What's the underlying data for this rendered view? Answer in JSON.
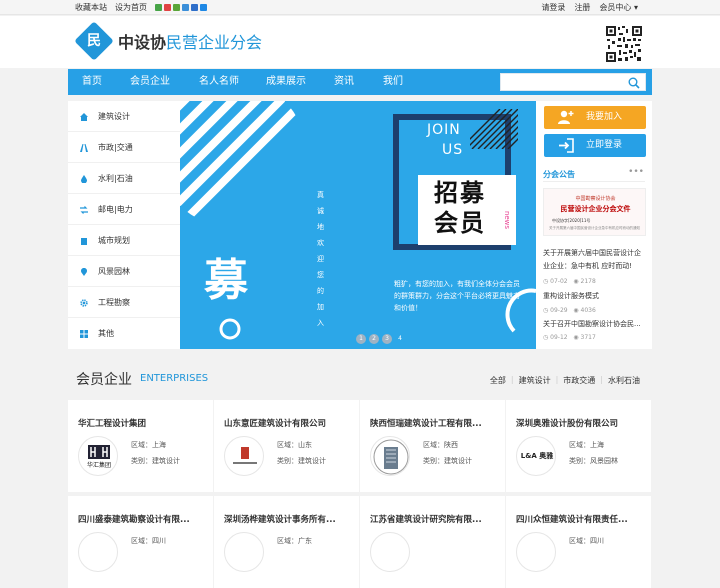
{
  "topbar": {
    "bookmark": "收藏本站",
    "set_home": "设为首页",
    "login": "请登录",
    "register": "注册",
    "member_center": "会员中心"
  },
  "brand": {
    "logo_char": "民",
    "name_a": "中设协",
    "name_b": "民营企业分会"
  },
  "nav": [
    "首页",
    "会员企业",
    "名人名师",
    "成果展示",
    "资讯",
    "我们"
  ],
  "search": {
    "placeholder": ""
  },
  "sidebar": [
    "建筑设计",
    "市政|交通",
    "水利|石油",
    "邮电|电力",
    "城市规划",
    "风景园林",
    "工程勘察",
    "其他"
  ],
  "banner": {
    "join": "JOIN",
    "us": "US",
    "zhao_mu": "招募",
    "hui_yuan": "会员",
    "news_tag": "news",
    "vertical": [
      "真",
      "诚",
      "地",
      "欢",
      "迎",
      "您",
      "的",
      "加",
      "入"
    ],
    "big_char": "募",
    "desc": "粗犷，有您的加入，有我们全体分会会员的群策群力，分会这个平台必将更具魅力和价值！",
    "dots": [
      "1",
      "2",
      "3",
      "4"
    ]
  },
  "right_panel": {
    "join_btn": "我要加入",
    "login_btn": "立即登录",
    "notice_title": "分会公告",
    "notice_more": "•••",
    "notice_img_line1": "中国勘察设计协会",
    "notice_img_line2": "民营设计企业分会文件",
    "notice_img_line3": "中设协字[2020]11号",
    "notice_img_line4": "关于开展第六届中国民营设计企业急中有机应时而动的通知",
    "news": [
      {
        "title": "关于开展第六届中国民营设计企业企业：急中有机 应时而动!",
        "date": "07-02",
        "views": "2178"
      },
      {
        "title": "重构设计服务模式",
        "date": "09-29",
        "views": "4036"
      },
      {
        "title": "关于召开中国勘察设计协会民...",
        "date": "09-12",
        "views": "3717"
      }
    ]
  },
  "members": {
    "title": "会员企业",
    "subtitle": "ENTERPRISES",
    "filters": [
      "全部",
      "|",
      "建筑设计",
      "|",
      "市政交通",
      "|",
      "水利石油"
    ],
    "cards": [
      {
        "name": "华汇工程设计集团",
        "region": "区域：上海",
        "category": "类别：建筑设计",
        "logo": "华汇集团"
      },
      {
        "name": "山东意匠建筑设计有限公司",
        "region": "区域：山东",
        "category": "类别：建筑设计",
        "logo": ""
      },
      {
        "name": "陕西恒瑞建筑设计工程有限...",
        "region": "区域：陕西",
        "category": "类别：建筑设计",
        "logo": ""
      },
      {
        "name": "深圳奥雅设计股份有限公司",
        "region": "区域：上海",
        "category": "类别：风景园林",
        "logo": "L&A 奥雅"
      },
      {
        "name": "四川盛泰建筑勘察设计有限...",
        "region": "区域：四川",
        "category": "",
        "logo": ""
      },
      {
        "name": "深圳汤桦建筑设计事务所有...",
        "region": "区域：广东",
        "category": "",
        "logo": ""
      },
      {
        "name": "江苏省建筑设计研究院有限...",
        "region": "",
        "category": "",
        "logo": ""
      },
      {
        "name": "四川众恒建筑设计有限责任...",
        "region": "区域：四川",
        "category": "",
        "logo": ""
      }
    ]
  },
  "colors": {
    "accent": "#2196d9",
    "nav": "#27a0e6",
    "orange": "#f5a623",
    "banner": "#2ca7e8"
  }
}
